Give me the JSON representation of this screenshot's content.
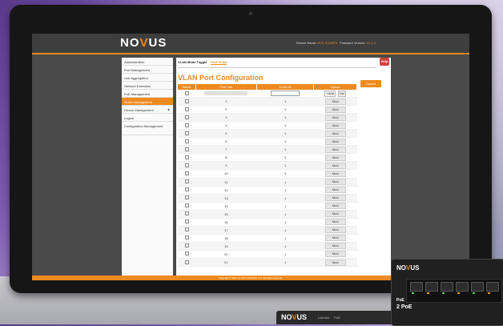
{
  "brand": {
    "pre": "NO",
    "v": "V",
    "post": "US"
  },
  "header": {
    "device_label": "Device Name:",
    "device_value": "NVS-SG06P5",
    "firmware_label": "Firmware Version:",
    "firmware_value": "V1.1.1"
  },
  "sidebar": {
    "items": [
      {
        "label": "Administration"
      },
      {
        "label": "Port Management"
      },
      {
        "label": "Link Aggregation"
      },
      {
        "label": "Network Extension"
      },
      {
        "label": "PoE Management"
      },
      {
        "label": "VLAN Management",
        "active": true
      },
      {
        "label": "Device Management",
        "arrow": "►"
      },
      {
        "label": "Logout"
      },
      {
        "label": "Configuration Management"
      }
    ]
  },
  "tabs": [
    {
      "label": "VLAN Mode Toggle"
    },
    {
      "label": "Port VLAN",
      "selected": true
    }
  ],
  "help_label": "Help",
  "page_title": "VLAN Port Configuration",
  "cancel_label": "Cancel",
  "table": {
    "headers": [
      "Select",
      "Port List",
      "VLAN ID",
      "Option"
    ],
    "add_label": "+Add",
    "del_label": "Del",
    "modify_label": "Mod",
    "rows": [
      {
        "port": "1",
        "vlan": "1"
      },
      {
        "port": "2",
        "vlan": "1"
      },
      {
        "port": "3",
        "vlan": "1"
      },
      {
        "port": "4",
        "vlan": "1"
      },
      {
        "port": "5",
        "vlan": "1"
      },
      {
        "port": "6",
        "vlan": "1"
      },
      {
        "port": "7",
        "vlan": "1"
      },
      {
        "port": "8",
        "vlan": "1"
      },
      {
        "port": "9",
        "vlan": "1"
      },
      {
        "port": "10",
        "vlan": "1"
      },
      {
        "port": "11",
        "vlan": "1"
      },
      {
        "port": "12",
        "vlan": "1"
      },
      {
        "port": "13",
        "vlan": "1"
      },
      {
        "port": "14",
        "vlan": "1"
      },
      {
        "port": "15",
        "vlan": "1"
      },
      {
        "port": "16",
        "vlan": "1"
      },
      {
        "port": "17",
        "vlan": "1"
      },
      {
        "port": "18",
        "vlan": "1"
      },
      {
        "port": "19",
        "vlan": "1"
      },
      {
        "port": "20",
        "vlan": "1"
      },
      {
        "port": "21",
        "vlan": "1"
      }
    ]
  },
  "footer": "Copyright © 2017 by AAT HOLDING S.A. All rights reserved.",
  "stand": {
    "items": [
      "Link/Act",
      "PoE"
    ]
  },
  "device": {
    "poe_label": "PoE",
    "poe_value": "2 PoE"
  },
  "colors": {
    "accent": "#ee8a1f",
    "led_green": "#49d14a",
    "led_orange": "#f0a020"
  }
}
